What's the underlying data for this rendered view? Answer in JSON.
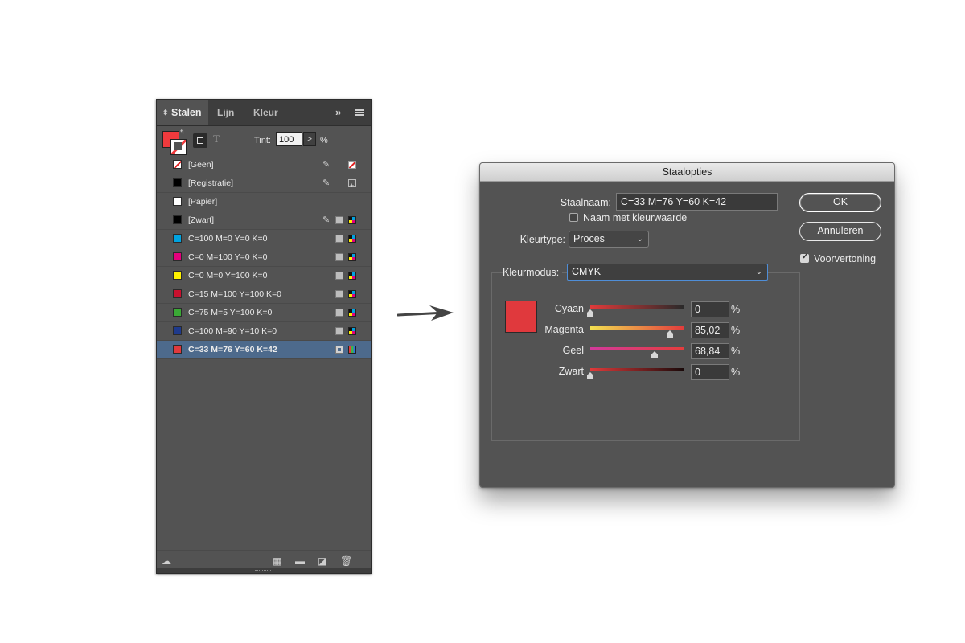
{
  "swatches_panel": {
    "tabs": [
      {
        "label": "Stalen",
        "active": true
      },
      {
        "label": "Lijn",
        "active": false
      },
      {
        "label": "Kleur",
        "active": false
      }
    ],
    "tint_label": "Tint:",
    "tint_value": "100",
    "tint_unit": "%",
    "fill_color": "#ef3a3d",
    "swatches": [
      {
        "name": "[Geen]",
        "color": "none",
        "icons": [
          "pencil-icon",
          "none-color-icon"
        ]
      },
      {
        "name": "[Registratie]",
        "color": "#000000",
        "icons": [
          "pencil-icon",
          "registration-icon"
        ]
      },
      {
        "name": "[Papier]",
        "color": "#ffffff",
        "icons": []
      },
      {
        "name": "[Zwart]",
        "color": "#000000",
        "icons": [
          "pencil-icon",
          "process-color-icon",
          "cmyk-mode-icon"
        ]
      },
      {
        "name": "C=100 M=0 Y=0 K=0",
        "color": "#00a3e0",
        "icons": [
          "process-color-icon",
          "cmyk-mode-icon"
        ]
      },
      {
        "name": "C=0 M=100 Y=0 K=0",
        "color": "#e4007c",
        "icons": [
          "process-color-icon",
          "cmyk-mode-icon"
        ]
      },
      {
        "name": "C=0 M=0 Y=100 K=0",
        "color": "#fff200",
        "icons": [
          "process-color-icon",
          "cmyk-mode-icon"
        ]
      },
      {
        "name": "C=15 M=100 Y=100 K=0",
        "color": "#c8102e",
        "icons": [
          "process-color-icon",
          "cmyk-mode-icon"
        ]
      },
      {
        "name": "C=75 M=5 Y=100 K=0",
        "color": "#3aa935",
        "icons": [
          "process-color-icon",
          "cmyk-mode-icon"
        ]
      },
      {
        "name": "C=100 M=90 Y=10 K=0",
        "color": "#1e3a8c",
        "icons": [
          "process-color-icon",
          "cmyk-mode-icon"
        ]
      },
      {
        "name": "C=33 M=76 Y=60 K=42",
        "color": "#e0393d",
        "selected": true,
        "icons": [
          "process-color-icon",
          "rgb-mode-icon"
        ]
      }
    ]
  },
  "dialog": {
    "title": "Staalopties",
    "swatch_name_label": "Staalnaam:",
    "swatch_name_value": "C=33 M=76 Y=60 K=42",
    "name_with_value_label": "Naam met kleurwaarde",
    "name_with_value_checked": false,
    "color_type_label": "Kleurtype:",
    "color_type_value": "Proces",
    "color_mode_label": "Kleurmodus:",
    "color_mode_value": "CMYK",
    "preview_color": "#e0393d",
    "sliders": [
      {
        "label": "Cyaan",
        "value": "0",
        "fraction": 0.0,
        "unit": "%",
        "gradient": [
          "#e03a3a",
          "#2a2a2a"
        ]
      },
      {
        "label": "Magenta",
        "value": "85,02",
        "fraction": 0.8502,
        "unit": "%",
        "gradient": [
          "#f2e050",
          "#e23c3c"
        ]
      },
      {
        "label": "Geel",
        "value": "68,84",
        "fraction": 0.6884,
        "unit": "%",
        "gradient": [
          "#d23a9c",
          "#e53d3d"
        ]
      },
      {
        "label": "Zwart",
        "value": "0",
        "fraction": 0.0,
        "unit": "%",
        "gradient": [
          "#e03a3a",
          "#1a0a0a"
        ]
      }
    ],
    "ok_label": "OK",
    "cancel_label": "Annuleren",
    "preview_label": "Voorvertoning",
    "preview_checked": true
  }
}
